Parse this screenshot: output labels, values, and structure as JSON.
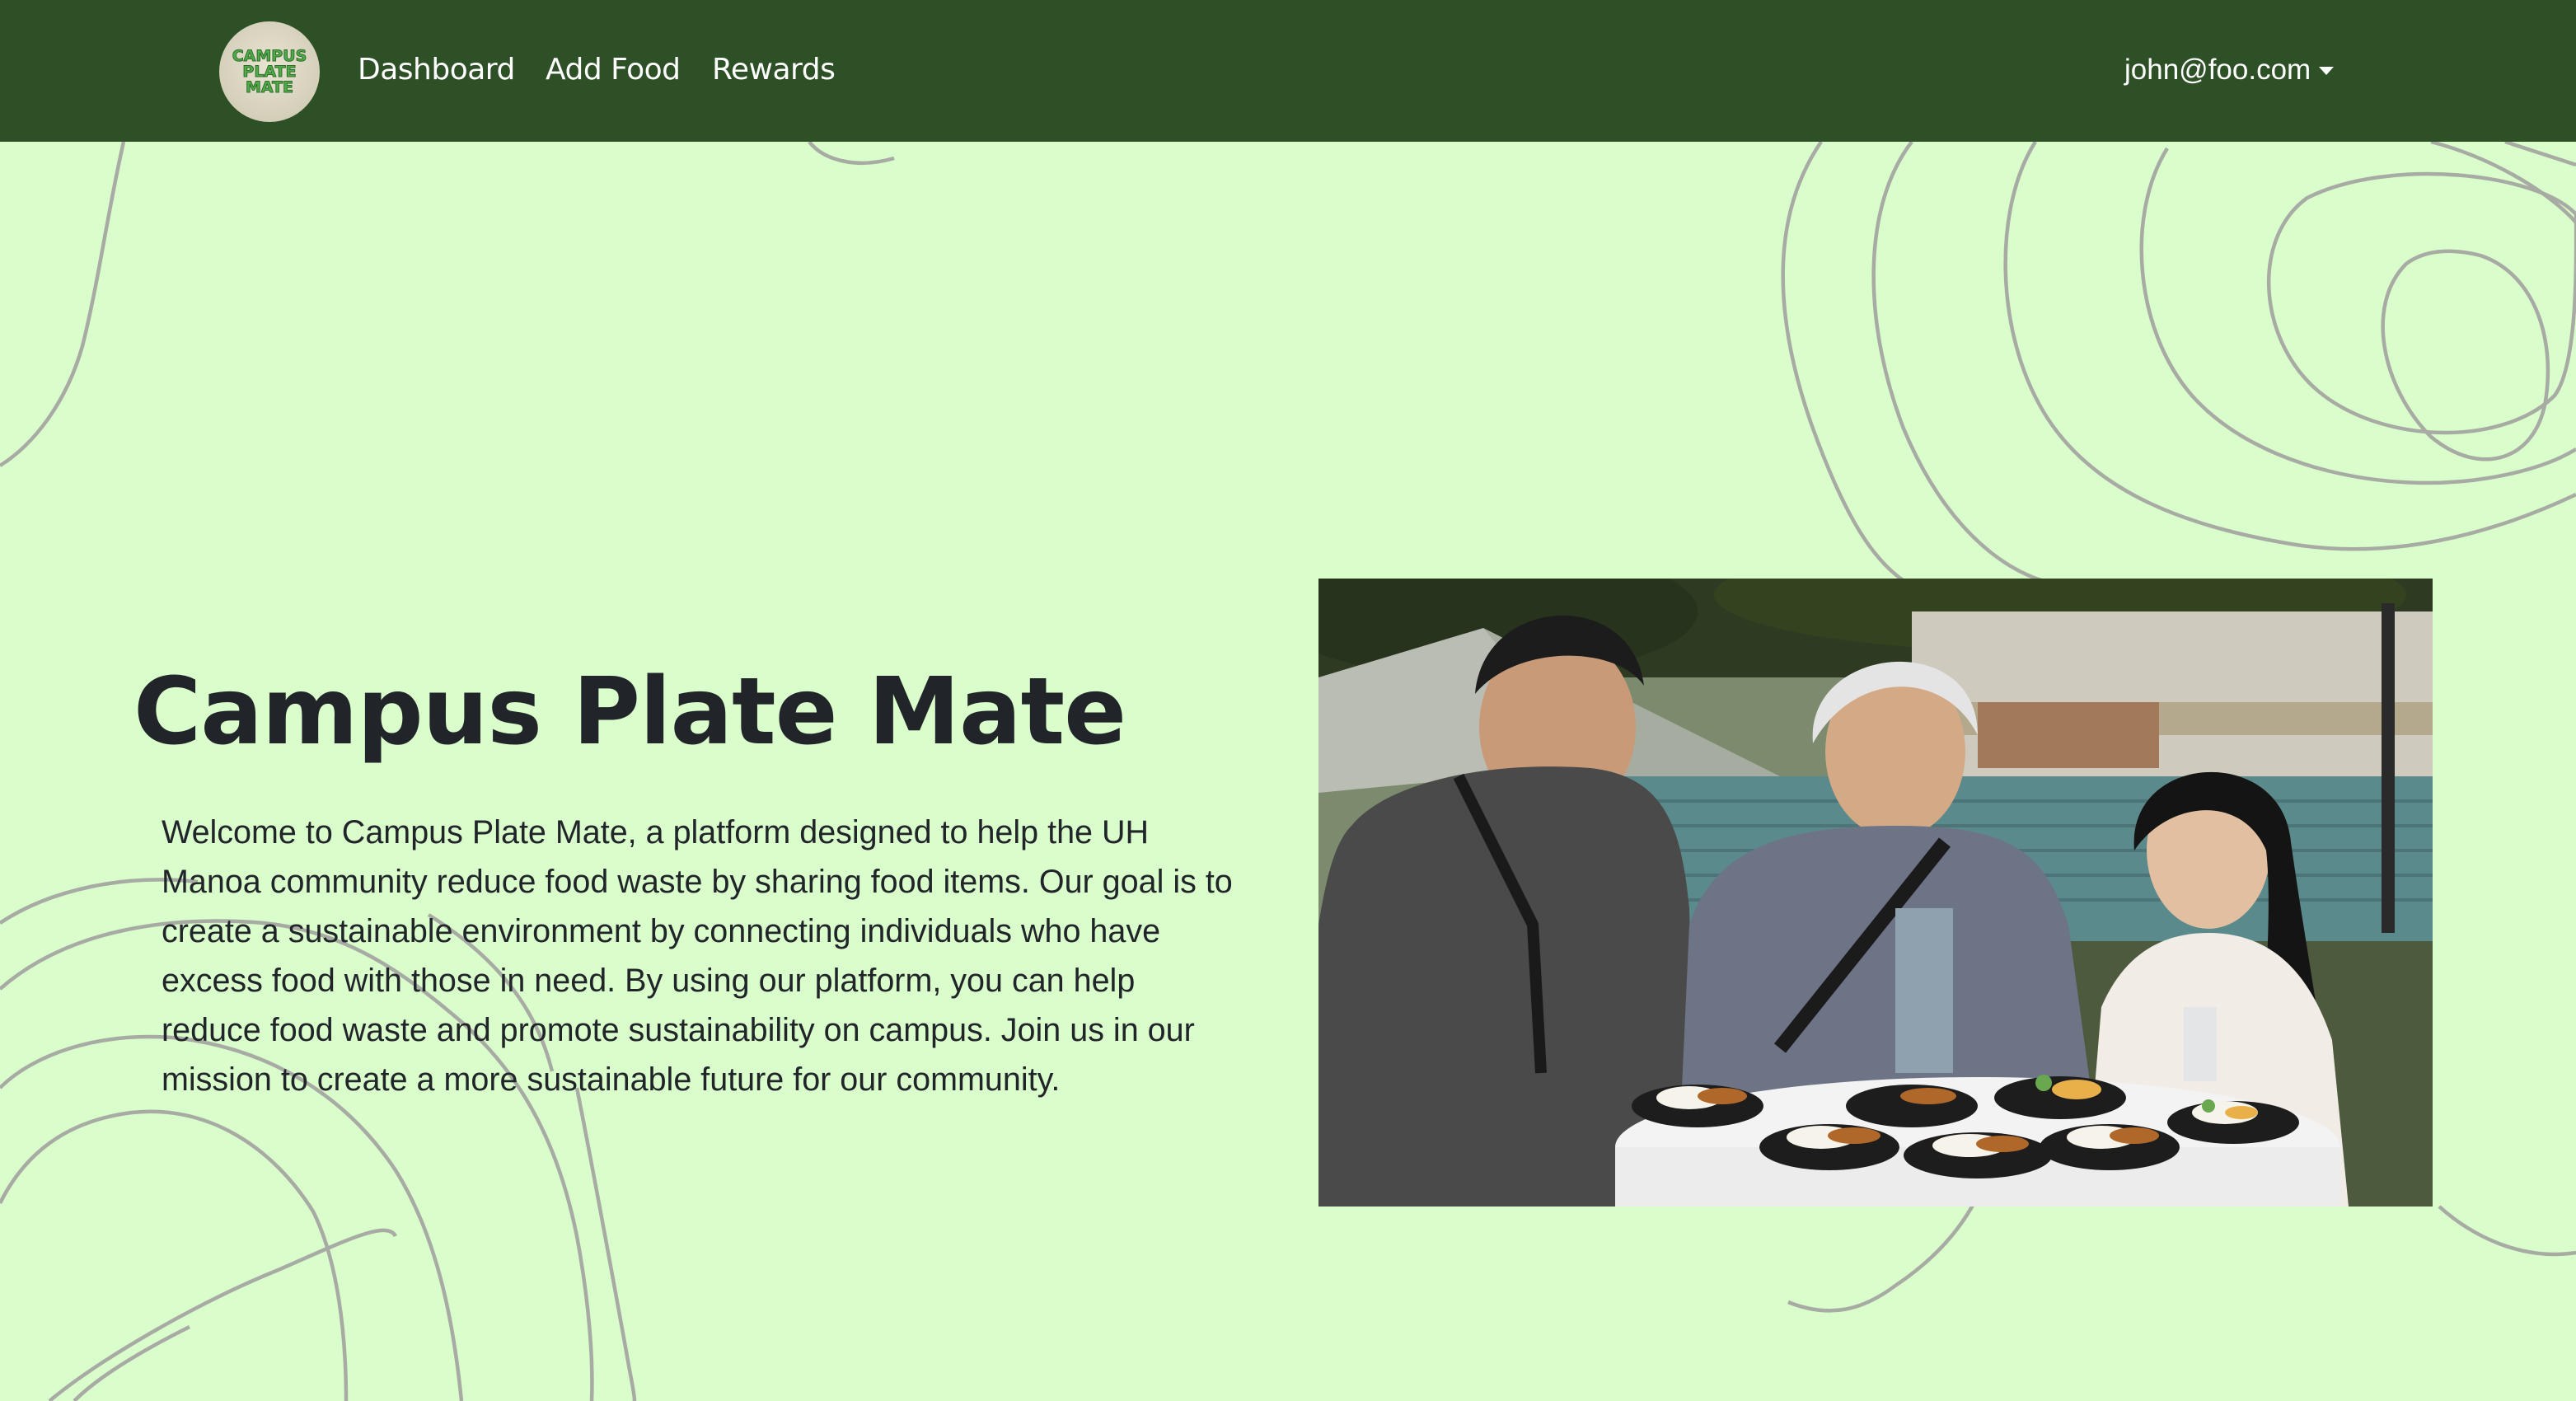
{
  "navbar": {
    "logo_lines": [
      "CAMPUS",
      "PLATE",
      "MATE"
    ],
    "links": [
      {
        "label": "Dashboard"
      },
      {
        "label": "Add Food"
      },
      {
        "label": "Rewards"
      }
    ],
    "user_email": "john@foo.com"
  },
  "hero": {
    "title": "Campus Plate Mate",
    "description": "Welcome to Campus Plate Mate, a platform designed to help the UH Manoa community reduce food waste by sharing food items. Our goal is to create a sustainable environment by connecting individuals who have excess food with those in need. By using our platform, you can help reduce food waste and promote sustainability on campus. Join us in our mission to create a more sustainable future for our community."
  },
  "colors": {
    "navbar": "#2e5026",
    "background": "#d9fdcb",
    "text": "#212529",
    "contour_lines": "#a8aaa4"
  }
}
